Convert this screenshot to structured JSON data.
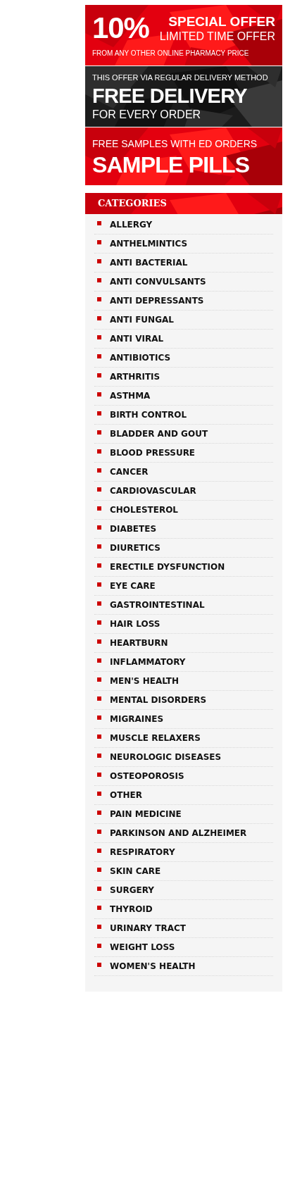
{
  "banners": [
    {
      "kind": "offer",
      "big": "10%",
      "headline": "SPECIAL OFFER",
      "subline": "LIMITED TIME OFFER",
      "note": "FROM ANY OTHER ONLINE PHARMACY PRICE"
    },
    {
      "kind": "delivery",
      "note": "THIS OFFER VIA REGULAR DELIVERY METHOD",
      "headline": "FREE DELIVERY",
      "subline": "FOR EVERY ORDER"
    },
    {
      "kind": "samples",
      "note": "FREE SAMPLES WITH ED ORDERS",
      "headline": "SAMPLE PILLS"
    }
  ],
  "categories": {
    "title": "CATEGORIES",
    "items": [
      "ALLERGY",
      "ANTHELMINTICS",
      "ANTI BACTERIAL",
      "ANTI CONVULSANTS",
      "ANTI DEPRESSANTS",
      "ANTI FUNGAL",
      "ANTI VIRAL",
      "ANTIBIOTICS",
      "ARTHRITIS",
      "ASTHMA",
      "BIRTH CONTROL",
      "BLADDER AND GOUT",
      "BLOOD PRESSURE",
      "CANCER",
      "CARDIOVASCULAR",
      "CHOLESTEROL",
      "DIABETES",
      "DIURETICS",
      "ERECTILE DYSFUNCTION",
      "EYE CARE",
      "GASTROINTESTINAL",
      "HAIR LOSS",
      "HEARTBURN",
      "INFLAMMATORY",
      "MEN'S HEALTH",
      "MENTAL DISORDERS",
      "MIGRAINES",
      "MUSCLE RELAXERS",
      "NEUROLOGIC DISEASES",
      "OSTEOPOROSIS",
      "OTHER",
      "PAIN MEDICINE",
      "PARKINSON AND ALZHEIMER",
      "RESPIRATORY",
      "SKIN CARE",
      "SURGERY",
      "THYROID",
      "URINARY TRACT",
      "WEIGHT LOSS",
      "WOMEN'S HEALTH"
    ]
  }
}
